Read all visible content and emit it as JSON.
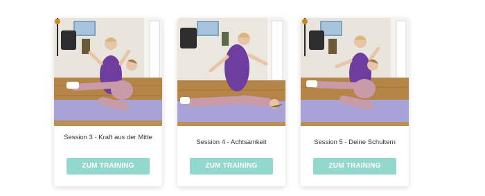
{
  "colors": {
    "button_bg": "#93d8cd",
    "button_text": "#ffffff",
    "mat": "#a7a3d6",
    "floor": "#b58548"
  },
  "sessions": [
    {
      "title": "Session 3 - Kraft aus der Mitte",
      "button_label": "ZUM TRAINING",
      "thumbnail_icon": "video-thumbnail"
    },
    {
      "title": "Session 4 - Achtsamkeit",
      "button_label": "ZUM TRAINING",
      "thumbnail_icon": "video-thumbnail"
    },
    {
      "title": "Session 5 - Deine Schultern",
      "button_label": "ZUM TRAINING",
      "thumbnail_icon": "video-thumbnail"
    }
  ]
}
